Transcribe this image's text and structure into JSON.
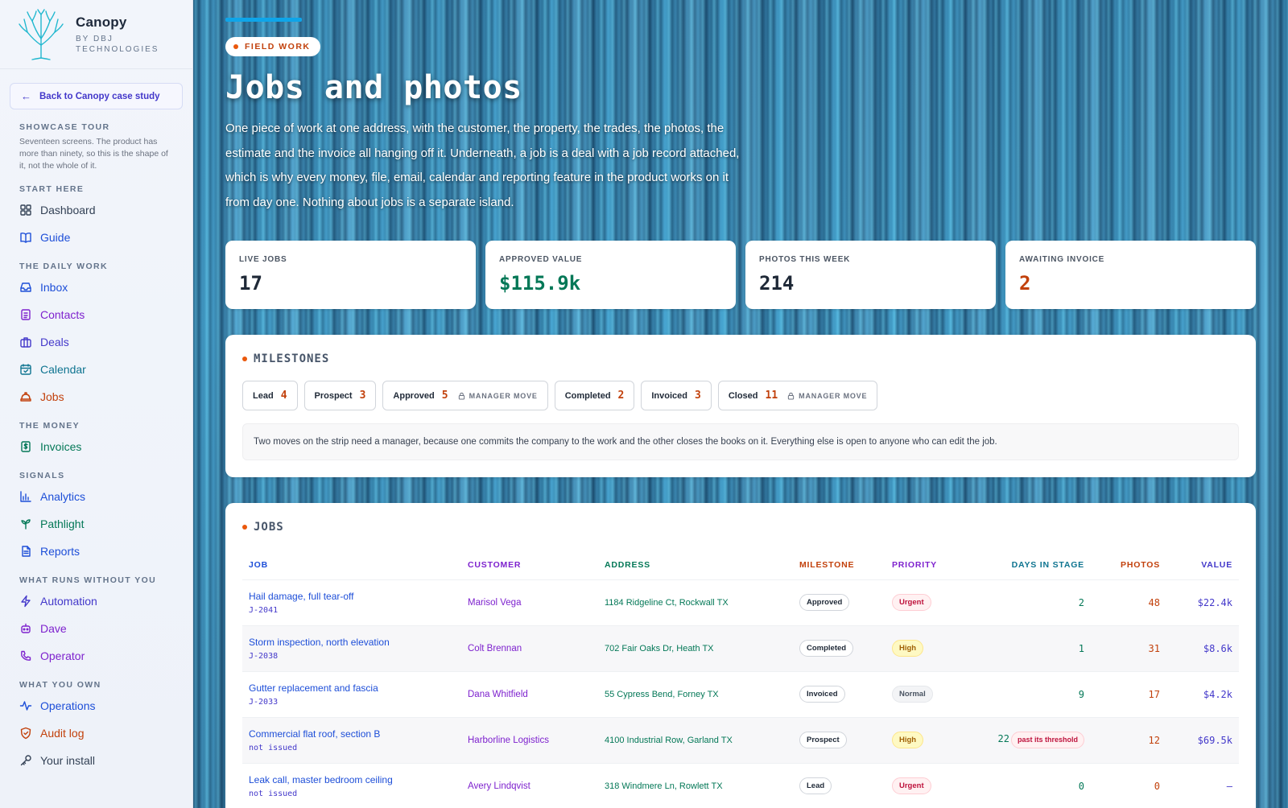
{
  "brand": {
    "name": "Canopy",
    "sub": "BY DBJ TECHNOLOGIES"
  },
  "back_label": "Back to Canopy case study",
  "tour": {
    "heading": "SHOWCASE TOUR",
    "desc": "Seventeen screens. The product has more than ninety, so this is the shape of it, not the whole of it."
  },
  "nav": {
    "start": {
      "heading": "START HERE",
      "items": [
        {
          "label": "Dashboard",
          "icon": "dashboard-icon",
          "color": "#334155"
        },
        {
          "label": "Guide",
          "icon": "book-icon",
          "color": "#1d4ed8"
        }
      ]
    },
    "daily": {
      "heading": "THE DAILY WORK",
      "items": [
        {
          "label": "Inbox",
          "icon": "inbox-icon",
          "color": "#1d4ed8"
        },
        {
          "label": "Contacts",
          "icon": "contacts-icon",
          "color": "#7e22ce"
        },
        {
          "label": "Deals",
          "icon": "briefcase-icon",
          "color": "#4338ca"
        },
        {
          "label": "Calendar",
          "icon": "calendar-icon",
          "color": "#0e7490"
        },
        {
          "label": "Jobs",
          "icon": "hardhat-icon",
          "color": "#c2410c"
        }
      ]
    },
    "money": {
      "heading": "THE MONEY",
      "items": [
        {
          "label": "Invoices",
          "icon": "invoice-icon",
          "color": "#047857"
        }
      ]
    },
    "signals": {
      "heading": "SIGNALS",
      "items": [
        {
          "label": "Analytics",
          "icon": "bar-chart-icon",
          "color": "#1d4ed8"
        },
        {
          "label": "Pathlight",
          "icon": "sprout-icon",
          "color": "#047857"
        },
        {
          "label": "Reports",
          "icon": "report-icon",
          "color": "#1d4ed8"
        }
      ]
    },
    "runs": {
      "heading": "WHAT RUNS WITHOUT YOU",
      "items": [
        {
          "label": "Automation",
          "icon": "lightning-icon",
          "color": "#4338ca"
        },
        {
          "label": "Dave",
          "icon": "bot-icon",
          "color": "#7e22ce"
        },
        {
          "label": "Operator",
          "icon": "phone-icon",
          "color": "#7e22ce"
        }
      ]
    },
    "own": {
      "heading": "WHAT YOU OWN",
      "items": [
        {
          "label": "Operations",
          "icon": "activity-icon",
          "color": "#1d4ed8"
        },
        {
          "label": "Audit log",
          "icon": "shield-icon",
          "color": "#c2410c"
        },
        {
          "label": "Your install",
          "icon": "key-icon",
          "color": "#334155"
        }
      ]
    }
  },
  "hero": {
    "pill": "FIELD WORK",
    "title": "Jobs and photos",
    "intro": "One piece of work at one address, with the customer, the property, the trades, the photos, the estimate and the invoice all hanging off it. Underneath, a job is a deal with a job record attached, which is why every money, file, email, calendar and reporting feature in the product works on it from day one. Nothing about jobs is a separate island."
  },
  "stats": [
    {
      "label": "LIVE JOBS",
      "value": "17",
      "color": "#1f2937"
    },
    {
      "label": "APPROVED VALUE",
      "value": "$115.9k",
      "color": "#047857"
    },
    {
      "label": "PHOTOS THIS WEEK",
      "value": "214",
      "color": "#1f2937"
    },
    {
      "label": "AWAITING INVOICE",
      "value": "2",
      "color": "#c2410c"
    }
  ],
  "milestones": {
    "title": "MILESTONES",
    "chips": [
      {
        "label": "Lead",
        "count": "4",
        "lock": ""
      },
      {
        "label": "Prospect",
        "count": "3",
        "lock": ""
      },
      {
        "label": "Approved",
        "count": "5",
        "lock": "MANAGER MOVE"
      },
      {
        "label": "Completed",
        "count": "2",
        "lock": ""
      },
      {
        "label": "Invoiced",
        "count": "3",
        "lock": ""
      },
      {
        "label": "Closed",
        "count": "11",
        "lock": "MANAGER MOVE"
      }
    ],
    "note": "Two moves on the strip need a manager, because one commits the company to the work and the other closes the books on it. Everything else is open to anyone who can edit the job."
  },
  "jobs": {
    "title": "JOBS",
    "columns": [
      {
        "label": "JOB",
        "color": "#1d4ed8",
        "align": "left"
      },
      {
        "label": "CUSTOMER",
        "color": "#7e22ce",
        "align": "left"
      },
      {
        "label": "ADDRESS",
        "color": "#047857",
        "align": "left"
      },
      {
        "label": "MILESTONE",
        "color": "#c2410c",
        "align": "left"
      },
      {
        "label": "PRIORITY",
        "color": "#7e22ce",
        "align": "left"
      },
      {
        "label": "DAYS IN STAGE",
        "color": "#0e7490",
        "align": "right"
      },
      {
        "label": "PHOTOS",
        "color": "#c2410c",
        "align": "right"
      },
      {
        "label": "VALUE",
        "color": "#4338ca",
        "align": "right"
      }
    ],
    "rows": [
      {
        "title": "Hail damage, full tear-off",
        "id": "J-2041",
        "customer": "Marisol Vega",
        "address": "1184 Ridgeline Ct, Rockwall TX",
        "milestone": "Approved",
        "priority": "Urgent",
        "days": "2",
        "threshold": "",
        "photos": "48",
        "value": "$22.4k"
      },
      {
        "title": "Storm inspection, north elevation",
        "id": "J-2038",
        "customer": "Colt Brennan",
        "address": "702 Fair Oaks Dr, Heath TX",
        "milestone": "Completed",
        "priority": "High",
        "days": "1",
        "threshold": "",
        "photos": "31",
        "value": "$8.6k"
      },
      {
        "title": "Gutter replacement and fascia",
        "id": "J-2033",
        "customer": "Dana Whitfield",
        "address": "55 Cypress Bend, Forney TX",
        "milestone": "Invoiced",
        "priority": "Normal",
        "days": "9",
        "threshold": "",
        "photos": "17",
        "value": "$4.2k"
      },
      {
        "title": "Commercial flat roof, section B",
        "id": "not issued",
        "customer": "Harborline Logistics",
        "address": "4100 Industrial Row, Garland TX",
        "milestone": "Prospect",
        "priority": "High",
        "days": "22",
        "threshold": "past its threshold",
        "photos": "12",
        "value": "$69.5k"
      },
      {
        "title": "Leak call, master bedroom ceiling",
        "id": "not issued",
        "customer": "Avery Lindqvist",
        "address": "318 Windmere Ln, Rowlett TX",
        "milestone": "Lead",
        "priority": "Urgent",
        "days": "0",
        "threshold": "",
        "photos": "0",
        "value": "—"
      }
    ]
  }
}
